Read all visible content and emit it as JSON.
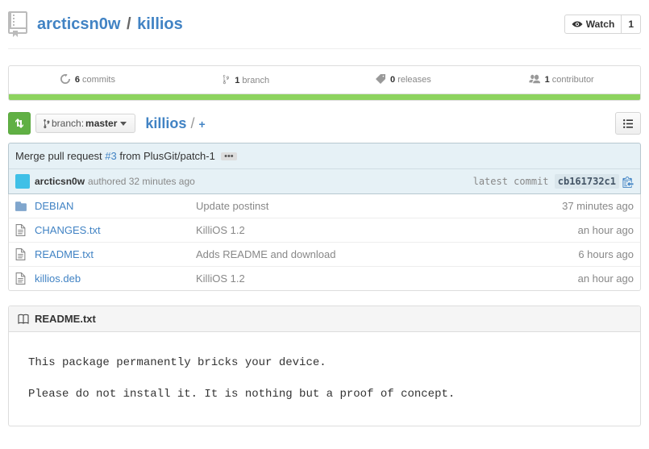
{
  "header": {
    "owner": "arcticsn0w",
    "sep": "/",
    "repo": "killios",
    "watch_label": "Watch",
    "watch_count": "1"
  },
  "stats": {
    "commits_count": "6",
    "commits_label": "commits",
    "branches_count": "1",
    "branches_label": "branch",
    "releases_count": "0",
    "releases_label": "releases",
    "contributors_count": "1",
    "contributors_label": "contributor"
  },
  "branch": {
    "picker_label": "branch:",
    "picker_value": "master",
    "crumb_repo": "killios",
    "crumb_sep": "/",
    "crumb_plus": "+"
  },
  "commit": {
    "msg_prefix": "Merge pull request ",
    "pr": "#3",
    "msg_suffix": " from PlusGit/patch-1",
    "dots": "•••",
    "author": "arcticsn0w",
    "authored_text": "authored 32 minutes ago",
    "latest_label": "latest commit ",
    "sha": "cb161732c1"
  },
  "files": [
    {
      "type": "dir",
      "name": "DEBIAN",
      "msg": "Update postinst",
      "time": "37 minutes ago"
    },
    {
      "type": "file",
      "name": "CHANGES.txt",
      "msg": "KilliOS 1.2",
      "time": "an hour ago"
    },
    {
      "type": "file",
      "name": "README.txt",
      "msg": "Adds README and download",
      "time": "6 hours ago"
    },
    {
      "type": "file",
      "name": "killios.deb",
      "msg": "KilliOS 1.2",
      "time": "an hour ago"
    }
  ],
  "readme": {
    "title": "README.txt",
    "p1": "This package permanently bricks your device.",
    "p2": "Please do not install it. It is nothing but a proof of concept."
  }
}
